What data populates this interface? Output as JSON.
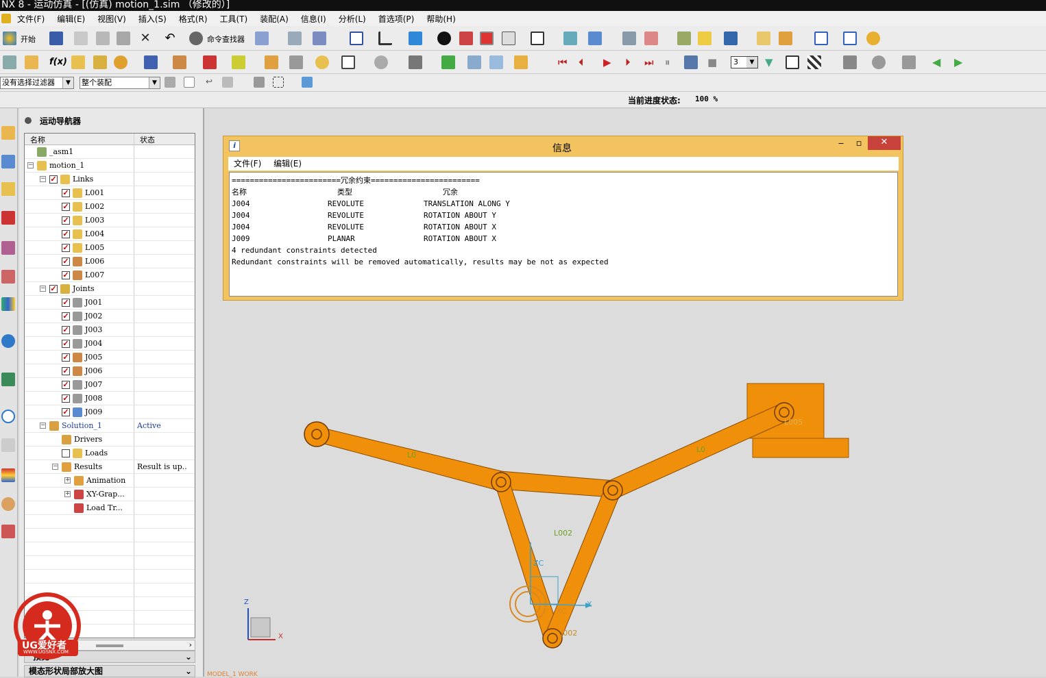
{
  "window": {
    "title": "NX 8 - 运动仿真 - [(仿真) motion_1.sim （修改的）]"
  },
  "menu": [
    "文件(F)",
    "编辑(E)",
    "视图(V)",
    "插入(S)",
    "格式(R)",
    "工具(T)",
    "装配(A)",
    "信息(I)",
    "分析(L)",
    "首选项(P)",
    "帮助(H)"
  ],
  "toolbar": {
    "start_label": "开始",
    "command_finder_label": "命令查找器",
    "frame_value": "3"
  },
  "filters": {
    "selection_filter": "没有选择过滤器",
    "assembly_scope": "整个装配"
  },
  "status": {
    "progress_label": "当前进度状态:",
    "progress_value": "100 %"
  },
  "navigator": {
    "title": "运动导航器",
    "columns": [
      "名称",
      "状态"
    ],
    "rows": [
      {
        "name": "_asm1",
        "status": ""
      },
      {
        "name": "motion_1",
        "status": ""
      },
      {
        "name": "Links",
        "status": ""
      },
      {
        "name": "L001",
        "status": ""
      },
      {
        "name": "L002",
        "status": ""
      },
      {
        "name": "L003",
        "status": ""
      },
      {
        "name": "L004",
        "status": ""
      },
      {
        "name": "L005",
        "status": ""
      },
      {
        "name": "L006",
        "status": ""
      },
      {
        "name": "L007",
        "status": ""
      },
      {
        "name": "Joints",
        "status": ""
      },
      {
        "name": "J001",
        "status": ""
      },
      {
        "name": "J002",
        "status": ""
      },
      {
        "name": "J003",
        "status": ""
      },
      {
        "name": "J004",
        "status": ""
      },
      {
        "name": "J005",
        "status": ""
      },
      {
        "name": "J006",
        "status": ""
      },
      {
        "name": "J007",
        "status": ""
      },
      {
        "name": "J008",
        "status": ""
      },
      {
        "name": "J009",
        "status": ""
      },
      {
        "name": "Solution_1",
        "status": "Active"
      },
      {
        "name": "Drivers",
        "status": ""
      },
      {
        "name": "Loads",
        "status": ""
      },
      {
        "name": "Results",
        "status": "Result is up.."
      },
      {
        "name": "Animation",
        "status": ""
      },
      {
        "name": "XY-Grap...",
        "status": ""
      },
      {
        "name": "Load Tr...",
        "status": ""
      }
    ],
    "preview_label": "预览",
    "mode_shape_label": "模态形状局部放大图"
  },
  "info_dialog": {
    "title": "信息",
    "menu": [
      "文件(F)",
      "编辑(E)"
    ],
    "header_line": "========================冗余约束========================",
    "columns": [
      "名称",
      "类型",
      "冗余"
    ],
    "rows": [
      {
        "name": "J004",
        "type": "REVOLUTE",
        "redundancy": "TRANSLATION ALONG Y"
      },
      {
        "name": "J004",
        "type": "REVOLUTE",
        "redundancy": "ROTATION ABOUT Y"
      },
      {
        "name": "J004",
        "type": "REVOLUTE",
        "redundancy": "ROTATION ABOUT X"
      },
      {
        "name": "J009",
        "type": "PLANAR",
        "redundancy": "ROTATION ABOUT X"
      }
    ],
    "summary_line": "4 redundant constraints detected",
    "warning_line": "Redundant constraints will be removed automatically, results may be not as expected"
  },
  "model": {
    "labels": {
      "link_left": "L0",
      "link_right": "L0",
      "link_mid": "L002",
      "bottom_joint": "J002",
      "right_block": "L005",
      "zc": "ZC",
      "xc": "XC",
      "x_axis": "X",
      "triad_z": "Z",
      "triad_x": "X"
    },
    "link_color": "#f0900a"
  },
  "watermark": {
    "brand": "UG爱好者",
    "url": "WWW.UGSNX.COM"
  },
  "viewport_footer": "MODEL_1 WORK"
}
